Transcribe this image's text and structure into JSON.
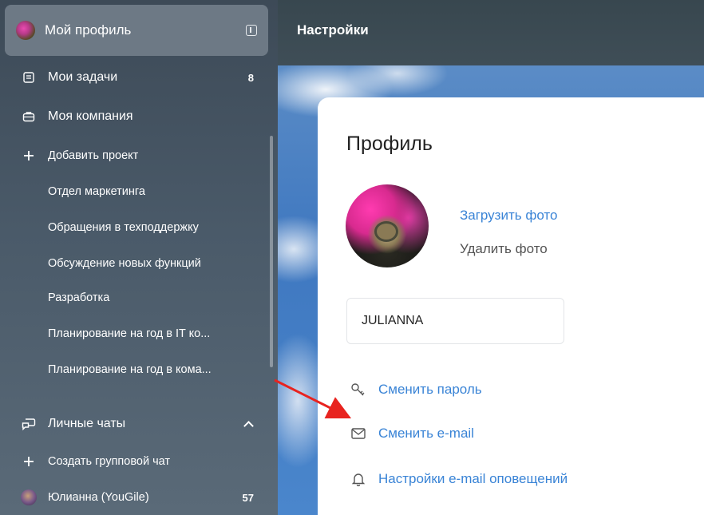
{
  "sidebar": {
    "profile_label": "Мой профиль",
    "tasks": {
      "label": "Мои задачи",
      "count": "8"
    },
    "company_label": "Моя компания",
    "add_project_label": "Добавить проект",
    "projects": [
      "Отдел маркетинга",
      "Обращения в техподдержку",
      "Обсуждение новых функций",
      "Разработка",
      "Планирование на год в IT ко...",
      "Планирование на год в кома..."
    ],
    "chats_section_label": "Личные чаты",
    "create_group_chat_label": "Создать групповой чат",
    "chat": {
      "label": "Юлианна (YouGile)",
      "count": "57"
    }
  },
  "header": {
    "title": "Настройки"
  },
  "profile": {
    "title": "Профиль",
    "upload_photo": "Загрузить фото",
    "delete_photo": "Удалить фото",
    "name_value": "JULIANNA",
    "actions": {
      "change_password": "Сменить пароль",
      "change_email": "Сменить e-mail",
      "email_notifications": "Настройки e-mail оповещений"
    }
  },
  "colors": {
    "accent_link": "#3a84d6",
    "annotation_arrow": "#e8231f"
  }
}
